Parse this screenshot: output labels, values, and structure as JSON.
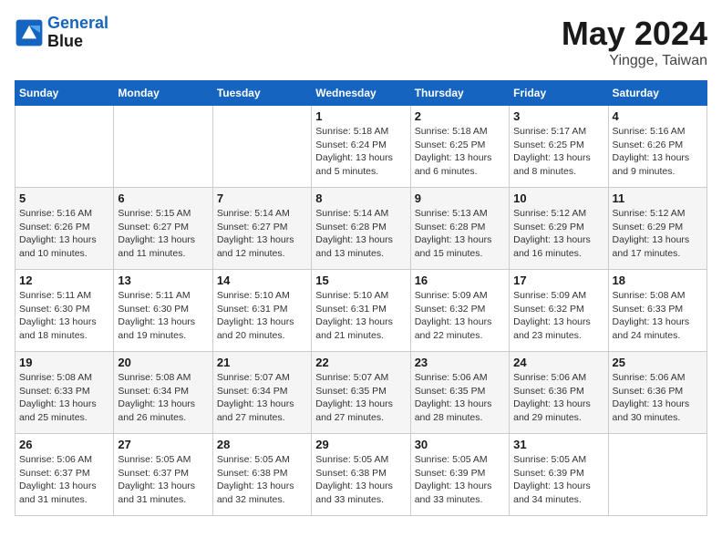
{
  "header": {
    "logo_line1": "General",
    "logo_line2": "Blue",
    "month": "May 2024",
    "location": "Yingge, Taiwan"
  },
  "weekdays": [
    "Sunday",
    "Monday",
    "Tuesday",
    "Wednesday",
    "Thursday",
    "Friday",
    "Saturday"
  ],
  "weeks": [
    [
      {
        "day": "",
        "info": ""
      },
      {
        "day": "",
        "info": ""
      },
      {
        "day": "",
        "info": ""
      },
      {
        "day": "1",
        "info": "Sunrise: 5:18 AM\nSunset: 6:24 PM\nDaylight: 13 hours\nand 5 minutes."
      },
      {
        "day": "2",
        "info": "Sunrise: 5:18 AM\nSunset: 6:25 PM\nDaylight: 13 hours\nand 6 minutes."
      },
      {
        "day": "3",
        "info": "Sunrise: 5:17 AM\nSunset: 6:25 PM\nDaylight: 13 hours\nand 8 minutes."
      },
      {
        "day": "4",
        "info": "Sunrise: 5:16 AM\nSunset: 6:26 PM\nDaylight: 13 hours\nand 9 minutes."
      }
    ],
    [
      {
        "day": "5",
        "info": "Sunrise: 5:16 AM\nSunset: 6:26 PM\nDaylight: 13 hours\nand 10 minutes."
      },
      {
        "day": "6",
        "info": "Sunrise: 5:15 AM\nSunset: 6:27 PM\nDaylight: 13 hours\nand 11 minutes."
      },
      {
        "day": "7",
        "info": "Sunrise: 5:14 AM\nSunset: 6:27 PM\nDaylight: 13 hours\nand 12 minutes."
      },
      {
        "day": "8",
        "info": "Sunrise: 5:14 AM\nSunset: 6:28 PM\nDaylight: 13 hours\nand 13 minutes."
      },
      {
        "day": "9",
        "info": "Sunrise: 5:13 AM\nSunset: 6:28 PM\nDaylight: 13 hours\nand 15 minutes."
      },
      {
        "day": "10",
        "info": "Sunrise: 5:12 AM\nSunset: 6:29 PM\nDaylight: 13 hours\nand 16 minutes."
      },
      {
        "day": "11",
        "info": "Sunrise: 5:12 AM\nSunset: 6:29 PM\nDaylight: 13 hours\nand 17 minutes."
      }
    ],
    [
      {
        "day": "12",
        "info": "Sunrise: 5:11 AM\nSunset: 6:30 PM\nDaylight: 13 hours\nand 18 minutes."
      },
      {
        "day": "13",
        "info": "Sunrise: 5:11 AM\nSunset: 6:30 PM\nDaylight: 13 hours\nand 19 minutes."
      },
      {
        "day": "14",
        "info": "Sunrise: 5:10 AM\nSunset: 6:31 PM\nDaylight: 13 hours\nand 20 minutes."
      },
      {
        "day": "15",
        "info": "Sunrise: 5:10 AM\nSunset: 6:31 PM\nDaylight: 13 hours\nand 21 minutes."
      },
      {
        "day": "16",
        "info": "Sunrise: 5:09 AM\nSunset: 6:32 PM\nDaylight: 13 hours\nand 22 minutes."
      },
      {
        "day": "17",
        "info": "Sunrise: 5:09 AM\nSunset: 6:32 PM\nDaylight: 13 hours\nand 23 minutes."
      },
      {
        "day": "18",
        "info": "Sunrise: 5:08 AM\nSunset: 6:33 PM\nDaylight: 13 hours\nand 24 minutes."
      }
    ],
    [
      {
        "day": "19",
        "info": "Sunrise: 5:08 AM\nSunset: 6:33 PM\nDaylight: 13 hours\nand 25 minutes."
      },
      {
        "day": "20",
        "info": "Sunrise: 5:08 AM\nSunset: 6:34 PM\nDaylight: 13 hours\nand 26 minutes."
      },
      {
        "day": "21",
        "info": "Sunrise: 5:07 AM\nSunset: 6:34 PM\nDaylight: 13 hours\nand 27 minutes."
      },
      {
        "day": "22",
        "info": "Sunrise: 5:07 AM\nSunset: 6:35 PM\nDaylight: 13 hours\nand 27 minutes."
      },
      {
        "day": "23",
        "info": "Sunrise: 5:06 AM\nSunset: 6:35 PM\nDaylight: 13 hours\nand 28 minutes."
      },
      {
        "day": "24",
        "info": "Sunrise: 5:06 AM\nSunset: 6:36 PM\nDaylight: 13 hours\nand 29 minutes."
      },
      {
        "day": "25",
        "info": "Sunrise: 5:06 AM\nSunset: 6:36 PM\nDaylight: 13 hours\nand 30 minutes."
      }
    ],
    [
      {
        "day": "26",
        "info": "Sunrise: 5:06 AM\nSunset: 6:37 PM\nDaylight: 13 hours\nand 31 minutes."
      },
      {
        "day": "27",
        "info": "Sunrise: 5:05 AM\nSunset: 6:37 PM\nDaylight: 13 hours\nand 31 minutes."
      },
      {
        "day": "28",
        "info": "Sunrise: 5:05 AM\nSunset: 6:38 PM\nDaylight: 13 hours\nand 32 minutes."
      },
      {
        "day": "29",
        "info": "Sunrise: 5:05 AM\nSunset: 6:38 PM\nDaylight: 13 hours\nand 33 minutes."
      },
      {
        "day": "30",
        "info": "Sunrise: 5:05 AM\nSunset: 6:39 PM\nDaylight: 13 hours\nand 33 minutes."
      },
      {
        "day": "31",
        "info": "Sunrise: 5:05 AM\nSunset: 6:39 PM\nDaylight: 13 hours\nand 34 minutes."
      },
      {
        "day": "",
        "info": ""
      }
    ]
  ]
}
